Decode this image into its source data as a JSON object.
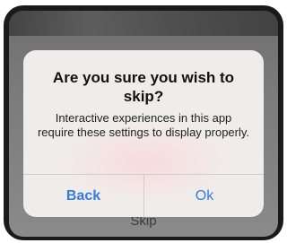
{
  "alert": {
    "title": "Are you sure you wish to skip?",
    "message": "Interactive experiences in this app require these settings to display properly.",
    "back_label": "Back",
    "ok_label": "Ok"
  },
  "background": {
    "skip_label": "Skip"
  },
  "colors": {
    "button_text": "#3a7bd5",
    "alert_background": "#f6f0f0",
    "screen_dim": "#7c7c7c"
  }
}
